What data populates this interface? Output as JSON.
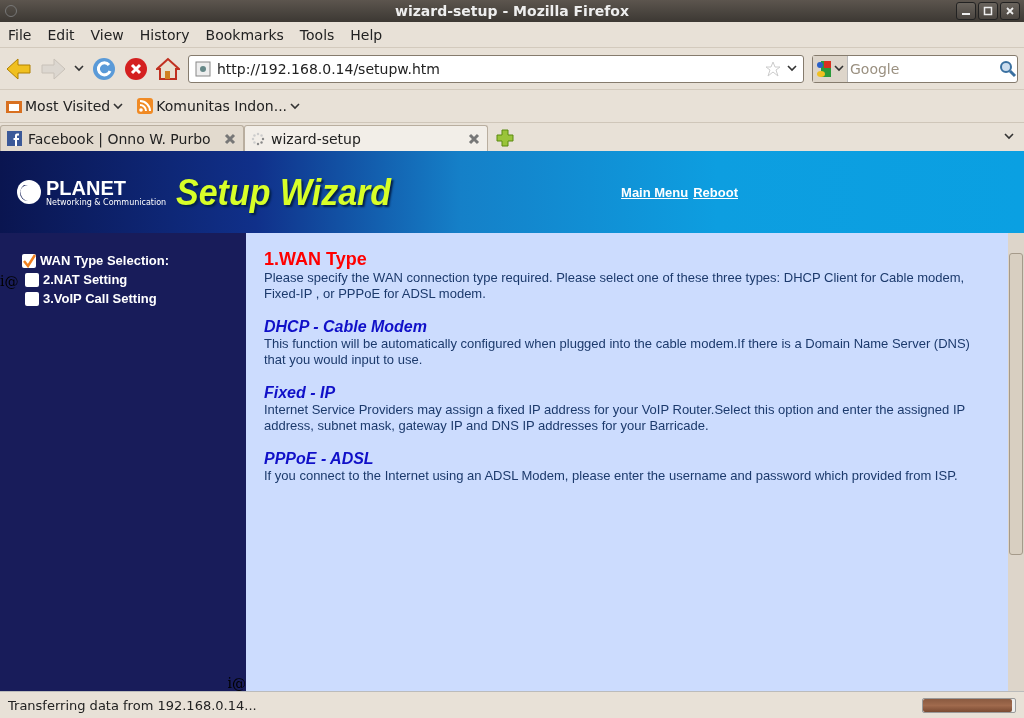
{
  "window": {
    "title": "wizard-setup - Mozilla Firefox"
  },
  "menu": [
    {
      "label": "File"
    },
    {
      "label": "Edit"
    },
    {
      "label": "View"
    },
    {
      "label": "History"
    },
    {
      "label": "Bookmarks"
    },
    {
      "label": "Tools"
    },
    {
      "label": "Help"
    }
  ],
  "address": {
    "value": "http://192.168.0.14/setupw.htm"
  },
  "search": {
    "placeholder": "Google"
  },
  "bookmarks": [
    {
      "label": "Most Visited",
      "kind": "folder"
    },
    {
      "label": "Komunitas Indon...",
      "kind": "feed"
    }
  ],
  "tabs": [
    {
      "label": "Facebook | Onno W. Purbo",
      "kind": "facebook",
      "selected": false
    },
    {
      "label": "wizard-setup",
      "kind": "loading",
      "selected": true
    }
  ],
  "banner": {
    "title": "Setup Wizard",
    "logo": "PLANET",
    "logo_sub": "Networking & Communication",
    "links": [
      "Main Menu",
      "Reboot"
    ]
  },
  "sidebar": {
    "stray_marks": [
      "i@",
      "i@"
    ],
    "items": [
      {
        "label": "WAN Type Selection:",
        "checked": true
      },
      {
        "label": "2.NAT Setting",
        "checked": false
      },
      {
        "label": "3.VoIP Call Setting",
        "checked": false
      }
    ]
  },
  "content": {
    "heading": "1.WAN Type",
    "intro": "Please specify the WAN connection type required. Please select one of these three types: DHCP Client for Cable modem, Fixed-IP , or PPPoE for ADSL modem.",
    "sections": [
      {
        "title": "DHCP - Cable Modem",
        "text": "This function  will be automatically configured when plugged into the cable modem.If there is a Domain Name Server (DNS) that you would input to use."
      },
      {
        "title": "Fixed - IP",
        "text": "Internet Service Providers may assign a fixed IP address for your VoIP Router.Select this option and enter the assigned IP address, subnet mask, gateway IP and DNS IP addresses for your Barricade."
      },
      {
        "title": "PPPoE - ADSL",
        "text": "If you connect to the Internet using an ADSL Modem, please enter the username and password which provided from ISP."
      }
    ]
  },
  "status_bar": {
    "text": "Transferring data from 192.168.0.14...",
    "level": 0.97
  }
}
